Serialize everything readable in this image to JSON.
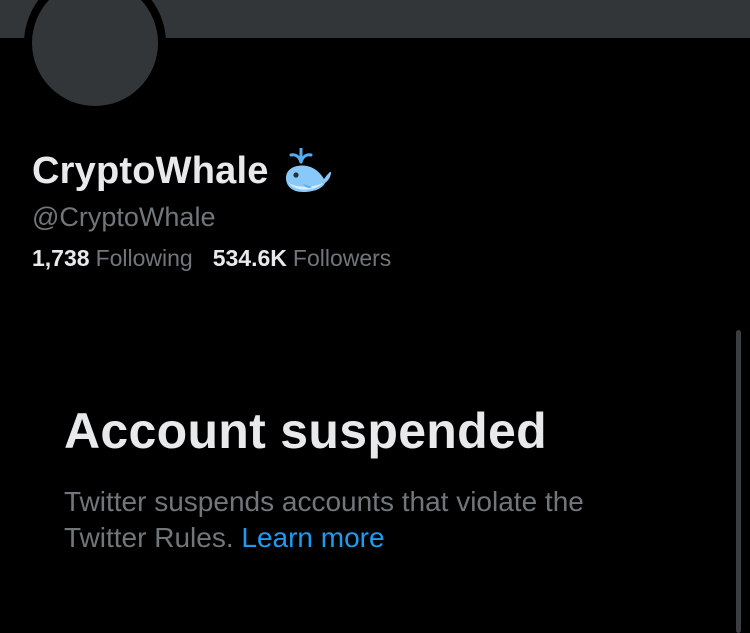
{
  "profile": {
    "display_name": "CryptoWhale",
    "badge_emoji": "spouting-whale",
    "handle": "@CryptoWhale",
    "following_count": "1,738",
    "following_label": "Following",
    "followers_count": "534.6K",
    "followers_label": "Followers"
  },
  "suspension": {
    "title": "Account suspended",
    "message": "Twitter suspends accounts that violate the Twitter Rules.",
    "link_label": "Learn more"
  },
  "colors": {
    "background": "#000000",
    "banner": "#333639",
    "primary_text": "#e7e9ea",
    "secondary_text": "#71767b",
    "link": "#1d9bf0"
  }
}
